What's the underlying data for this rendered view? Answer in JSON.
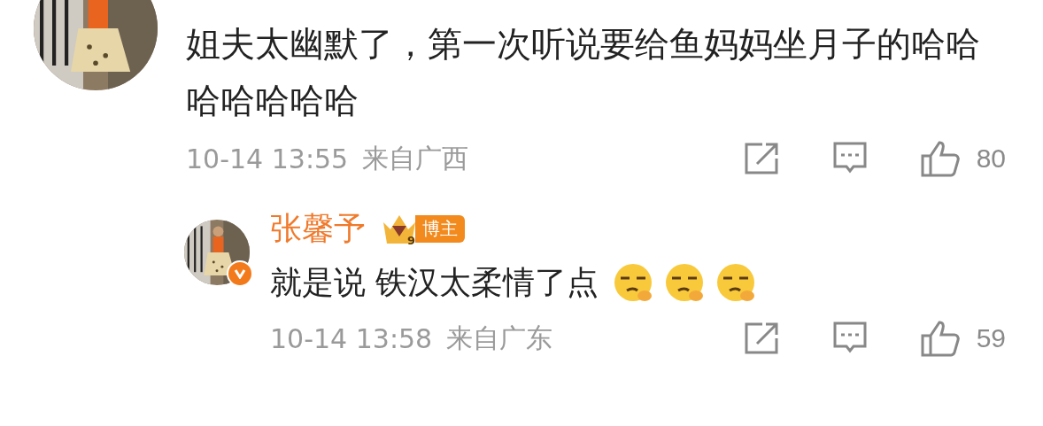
{
  "comment": {
    "text": "姐夫太幽默了，第一次听说要给鱼妈妈坐月子的哈哈哈哈哈哈哈",
    "time": "10-14 13:55",
    "location": "来自广西",
    "likes": "80",
    "reply": {
      "verified": true,
      "author": "张馨予",
      "crown_level": "9",
      "badge": "博主",
      "text": "就是说 铁汉太柔情了点",
      "emojis": [
        {
          "kind": "smirk"
        },
        {
          "kind": "smirk"
        },
        {
          "kind": "smirk"
        }
      ],
      "time": "10-14 13:58",
      "location": "来自广东",
      "likes": "59"
    }
  }
}
